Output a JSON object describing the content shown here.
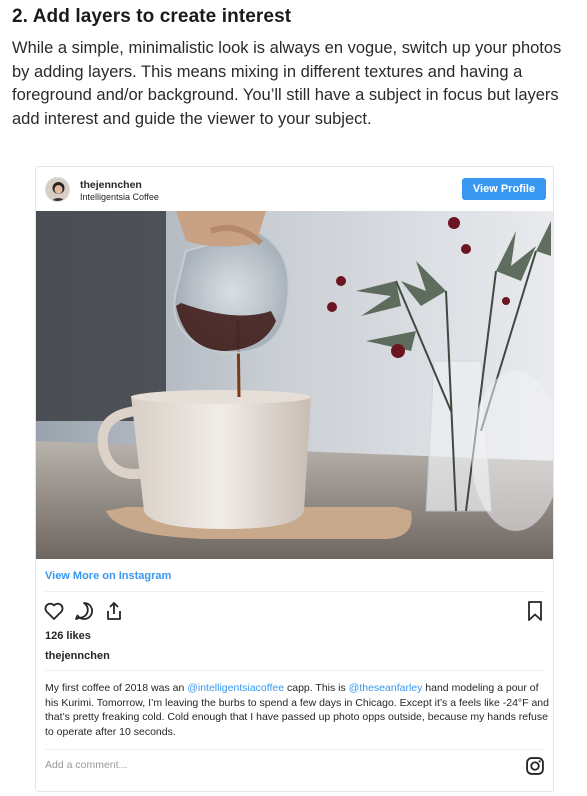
{
  "article": {
    "heading": "2. Add layers to create interest",
    "body": "While a simple, minimalistic look is always en vogue, switch up your photos by adding layers. This means mixing in different textures and having a foreground and/or background. You’ll still have a subject in focus but layers add interest and guide the viewer to your subject."
  },
  "post": {
    "username": "thejennchen",
    "location": "Intelligentsia Coffee",
    "view_profile_label": "View Profile",
    "view_more_label": "View More on Instagram",
    "likes": "126 likes",
    "caption_user": "thejennchen",
    "caption": {
      "part1": "My first coffee of 2018 was an ",
      "mention1": "@intelligentsiacoffee",
      "part2": " capp. This is ",
      "mention2": "@theseanfarley",
      "part3": " hand modeling a pour of his Kurimi. Tomorrow, I’m leaving the burbs to spend a few days in Chicago. Except it’s a feels like -24°F and that’s pretty freaking cold. Cold enough that I have passed up photo opps outside, because my hands refuse to operate after 10 seconds."
    },
    "comment_placeholder": "Add a comment...",
    "icons": [
      "heart-icon",
      "comment-icon",
      "share-icon",
      "bookmark-icon",
      "instagram-icon"
    ],
    "colors": {
      "accent": "#3897f0",
      "text": "#262626",
      "muted": "#999999"
    }
  }
}
